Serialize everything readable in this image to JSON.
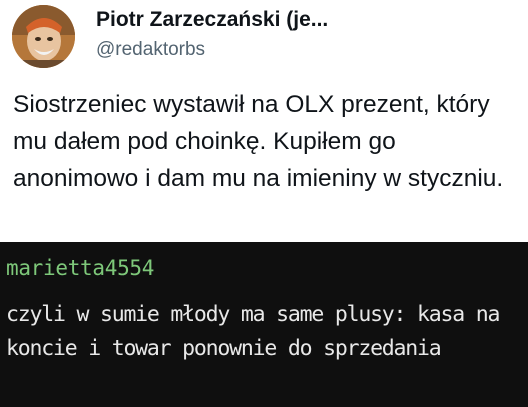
{
  "tweet": {
    "author_name": "Piotr Zarzeczański (je...",
    "handle": "@redaktorbs",
    "text": "Siostrzeniec wystawił na OLX prezent, który mu dałem pod choinkę. Kupiłem go anonimowo i dam mu na imieniny w styczniu."
  },
  "comment": {
    "username": "marietta4554",
    "text": "czyli w sumie młody ma same plusy: kasa na koncie i towar ponownie do sprzedania"
  },
  "colors": {
    "tweet_background": "#ffffff",
    "comment_background": "#0f0f0f",
    "username_green": "#7ec87a",
    "comment_text": "#e8e8e8",
    "handle_gray": "#536471"
  }
}
